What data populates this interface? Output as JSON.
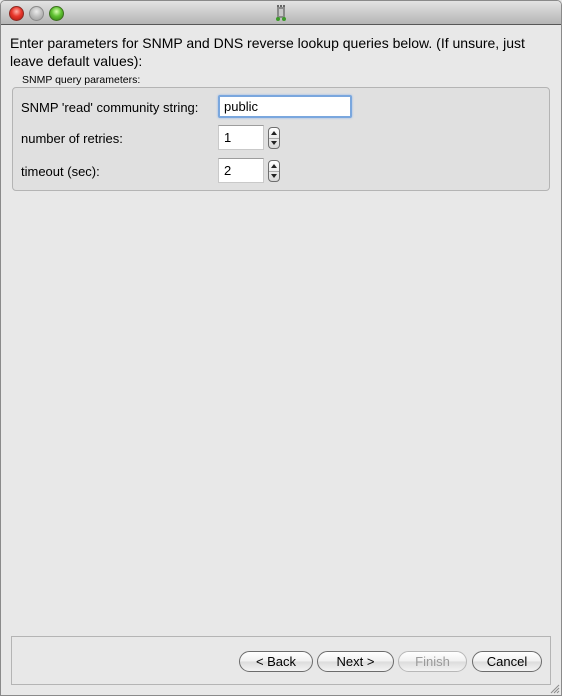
{
  "window": {
    "title_icon": "tower-icon"
  },
  "intro_text": "Enter parameters for SNMP and DNS reverse lookup queries below. (If unsure, just leave default values):",
  "snmp_group": {
    "label": "SNMP query parameters:",
    "community": {
      "label": "SNMP 'read' community string:",
      "value": "public"
    },
    "retries": {
      "label": "number of retries:",
      "value": "1"
    },
    "timeout": {
      "label": "timeout (sec):",
      "value": "2"
    }
  },
  "buttons": {
    "back": "< Back",
    "next": "Next >",
    "finish": "Finish",
    "cancel": "Cancel"
  },
  "colors": {
    "focus_ring": "#7aa7de",
    "close": "#e8372c",
    "zoom": "#5fc131"
  }
}
